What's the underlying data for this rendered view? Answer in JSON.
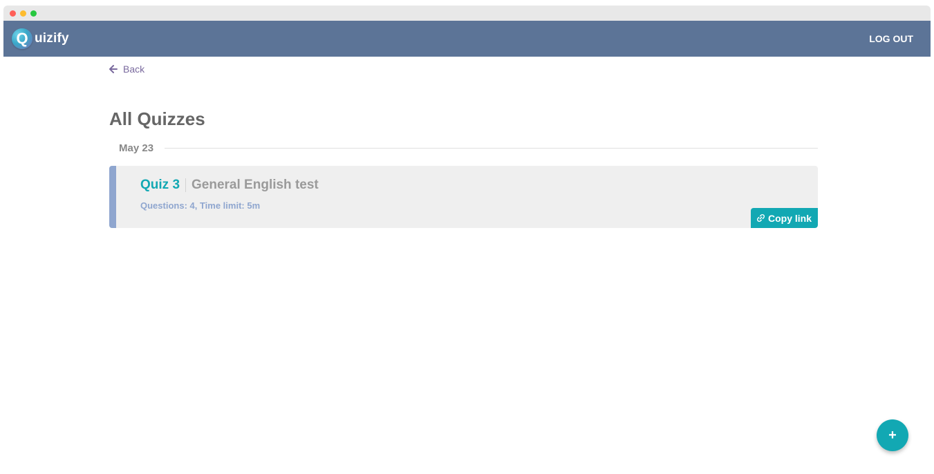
{
  "window": {
    "controls": [
      "close",
      "minimize",
      "zoom"
    ]
  },
  "navbar": {
    "logo_letter": "Q",
    "logo_text": "uizify",
    "logout_label": "LOG OUT",
    "background_color": "#5c7497"
  },
  "back": {
    "icon": "arrow-left-icon",
    "label": "Back"
  },
  "page": {
    "title": "All Quizzes"
  },
  "groups": [
    {
      "date": "May 23",
      "quizzes": [
        {
          "number": "Quiz 3",
          "title": "General English test",
          "meta": "Questions: 4, Time limit: 5m",
          "copy_link_label": "Copy link",
          "copy_link_icon": "link-icon"
        }
      ]
    }
  ],
  "fab": {
    "icon": "plus-icon",
    "label": "+"
  },
  "colors": {
    "accent": "#12a8b3",
    "card_accent": "#8fa6cf",
    "back_link": "#7a6a9e"
  }
}
